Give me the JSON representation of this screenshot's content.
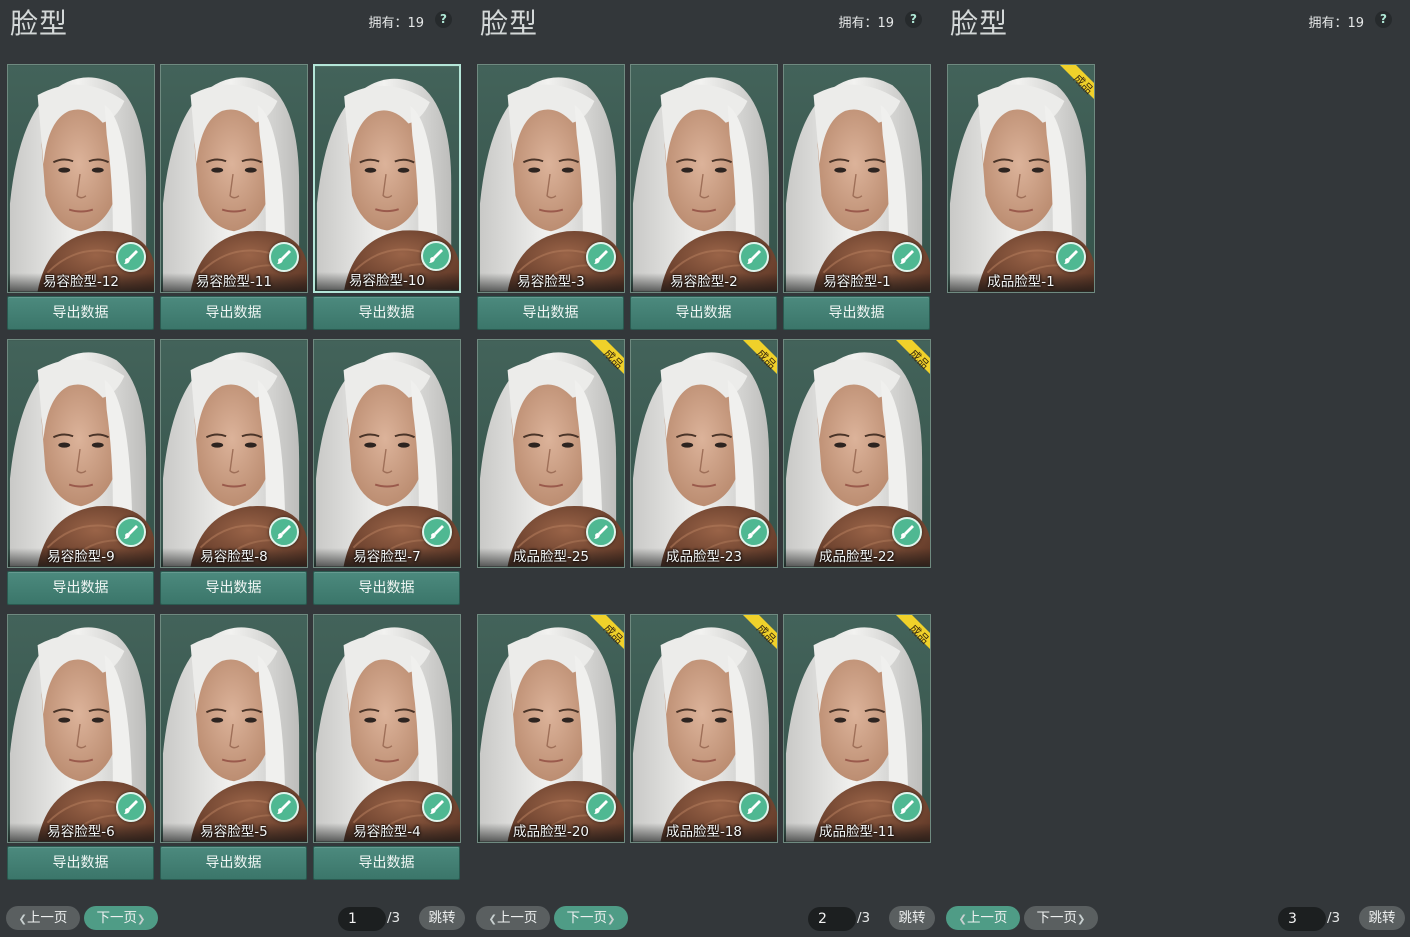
{
  "colors": {
    "background": "#33373a",
    "card_bg": "#3f5a52",
    "accent": "#4f9c86",
    "badge": "#f0d12a",
    "hair": "#e8e8e6",
    "fur": "#7a4a34"
  },
  "icons": {
    "edit": "brush-icon",
    "help": "question-icon",
    "badge": "finished-product-ribbon"
  },
  "panels": [
    {
      "title": "脸型",
      "owned": "拥有：19",
      "help": "?",
      "cards": [
        {
          "label": "易容脸型-12",
          "badge": false,
          "export": "导出数据"
        },
        {
          "label": "易容脸型-11",
          "badge": false,
          "export": "导出数据"
        },
        {
          "label": "易容脸型-10",
          "badge": false,
          "export": "导出数据",
          "selected": true
        },
        {
          "label": "易容脸型-9",
          "badge": false,
          "export": "导出数据"
        },
        {
          "label": "易容脸型-8",
          "badge": false,
          "export": "导出数据"
        },
        {
          "label": "易容脸型-7",
          "badge": false,
          "export": "导出数据"
        },
        {
          "label": "易容脸型-6",
          "badge": false,
          "export": "导出数据"
        },
        {
          "label": "易容脸型-5",
          "badge": false,
          "export": "导出数据"
        },
        {
          "label": "易容脸型-4",
          "badge": false,
          "export": "导出数据"
        }
      ],
      "prev": "上一页",
      "next": "下一页",
      "page": "1",
      "total": "/3",
      "jump": "跳转",
      "active": "next"
    },
    {
      "title": "脸型",
      "owned": "拥有：19",
      "help": "?",
      "cards": [
        {
          "label": "易容脸型-3",
          "badge": false,
          "export": "导出数据"
        },
        {
          "label": "易容脸型-2",
          "badge": false,
          "export": "导出数据"
        },
        {
          "label": "易容脸型-1",
          "badge": false,
          "export": "导出数据"
        },
        {
          "label": "成品脸型-25",
          "badge": true
        },
        {
          "label": "成品脸型-23",
          "badge": true
        },
        {
          "label": "成品脸型-22",
          "badge": true
        },
        {
          "label": "成品脸型-20",
          "badge": true
        },
        {
          "label": "成品脸型-18",
          "badge": true
        },
        {
          "label": "成品脸型-11",
          "badge": true
        }
      ],
      "prev": "上一页",
      "next": "下一页",
      "page": "2",
      "total": "/3",
      "jump": "跳转",
      "active": "next"
    },
    {
      "title": "脸型",
      "owned": "拥有：19",
      "help": "?",
      "cards": [
        {
          "label": "成品脸型-1",
          "badge": true
        }
      ],
      "prev": "上一页",
      "next": "下一页",
      "page": "3",
      "total": "/3",
      "jump": "跳转",
      "active": "prev"
    }
  ],
  "badge_text": "成品"
}
